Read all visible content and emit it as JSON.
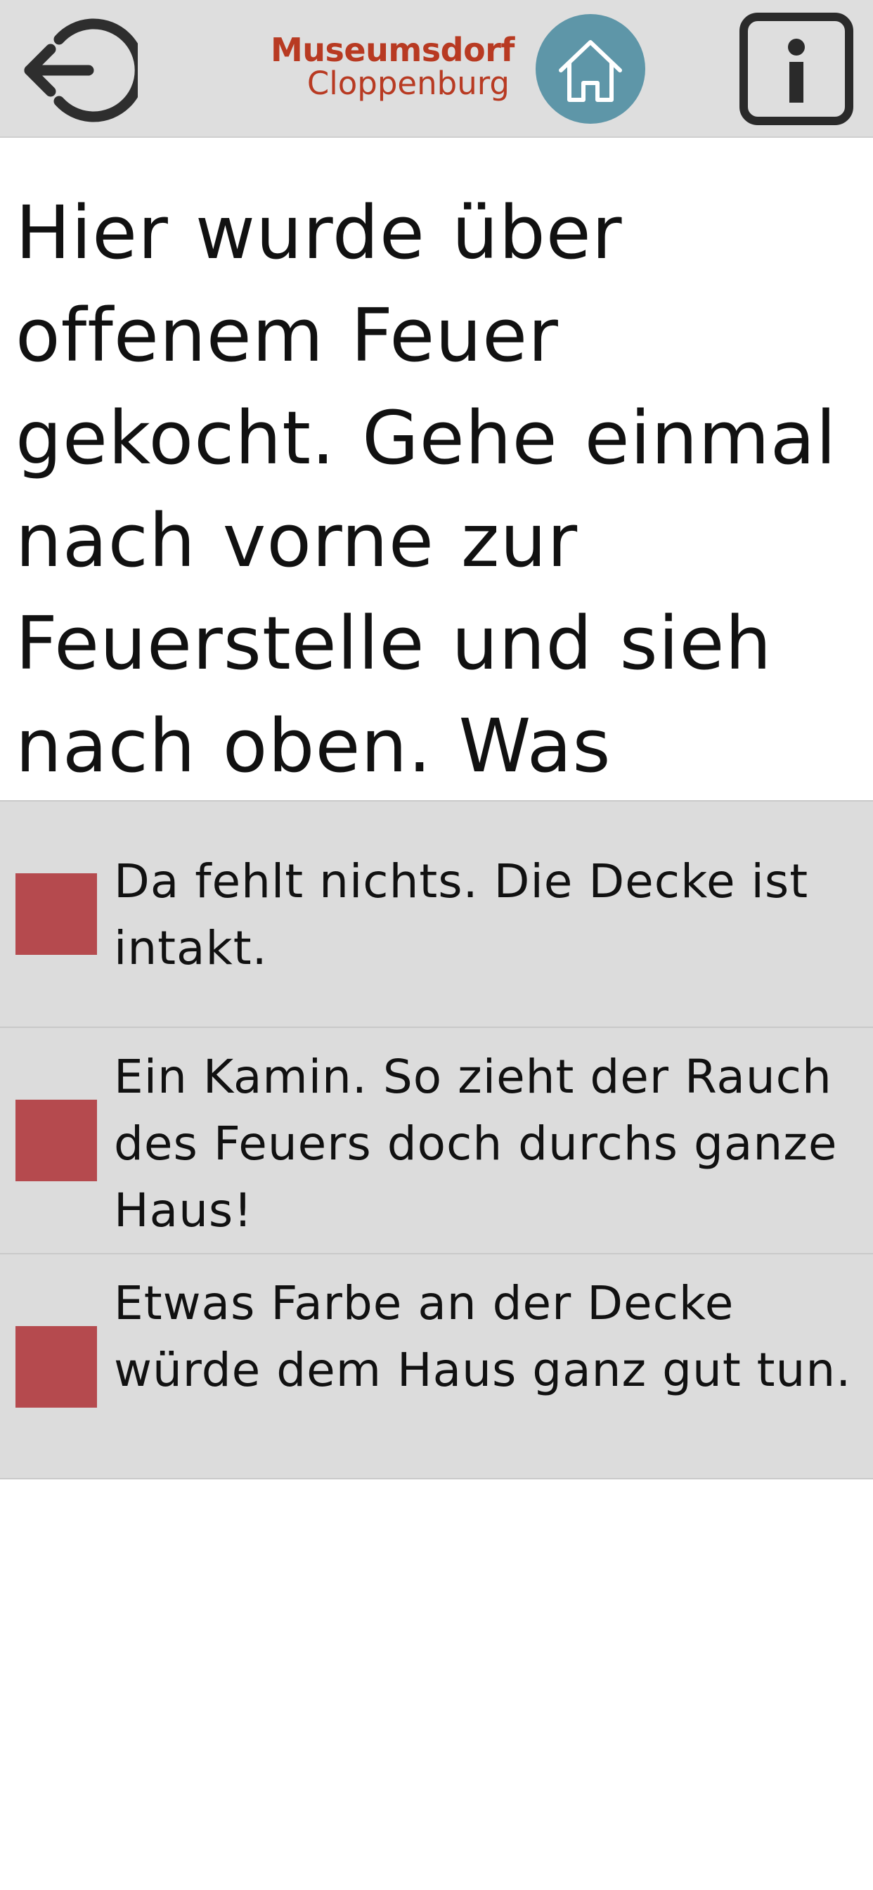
{
  "header": {
    "logo_line1": "Museumsdorf",
    "logo_line2": "Cloppenburg",
    "icons": {
      "back": "back-arrow-icon",
      "home": "home-icon",
      "info": "info-icon"
    },
    "colors": {
      "bar": "#dedede",
      "logo": "#b83a22",
      "home": "#5e96a8"
    }
  },
  "question": {
    "text": "Hier wurde über offenem Feuer gekocht. Gehe einmal nach vorne zur Feuerstelle und sieh nach oben. Was"
  },
  "answers": [
    {
      "text": "Da fehlt nichts. Die Decke ist intakt."
    },
    {
      "text": "Ein Kamin. So zieht der Rauch des Feuers doch durchs ganze Haus!"
    },
    {
      "text": "Etwas Farbe an der Decke würde dem Haus ganz gut tun."
    }
  ],
  "colors": {
    "answer_background": "#dcdcdc",
    "answer_marker": "#b54a4e"
  }
}
